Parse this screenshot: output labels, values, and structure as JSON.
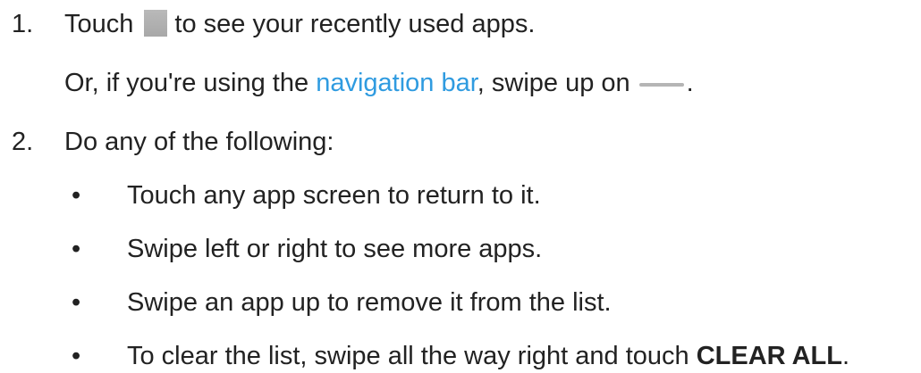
{
  "steps": [
    {
      "number": "1.",
      "text_before_icon": "Touch",
      "icon": "recent-apps-icon",
      "text_after_icon": "to see your recently used apps.",
      "alt_text_before_link": "Or, if you're using the",
      "alt_link": "navigation bar",
      "alt_text_after_link": ", swipe up on",
      "alt_icon": "nav-handle-icon",
      "alt_text_end": "."
    },
    {
      "number": "2.",
      "text": "Do any of the following:",
      "bullets": [
        {
          "text": "Touch any app screen to return to it."
        },
        {
          "text": "Swipe left or right to see more apps."
        },
        {
          "text": "Swipe an app up to remove it from the list."
        },
        {
          "text_before_bold": "To clear the list, swipe all the way right and touch",
          "bold": "CLEAR ALL",
          "text_end": "."
        }
      ]
    }
  ],
  "bullet_char": "•",
  "colors": {
    "text": "#222222",
    "link": "#2f9be0",
    "icon_gray": "#b0b0b0"
  }
}
